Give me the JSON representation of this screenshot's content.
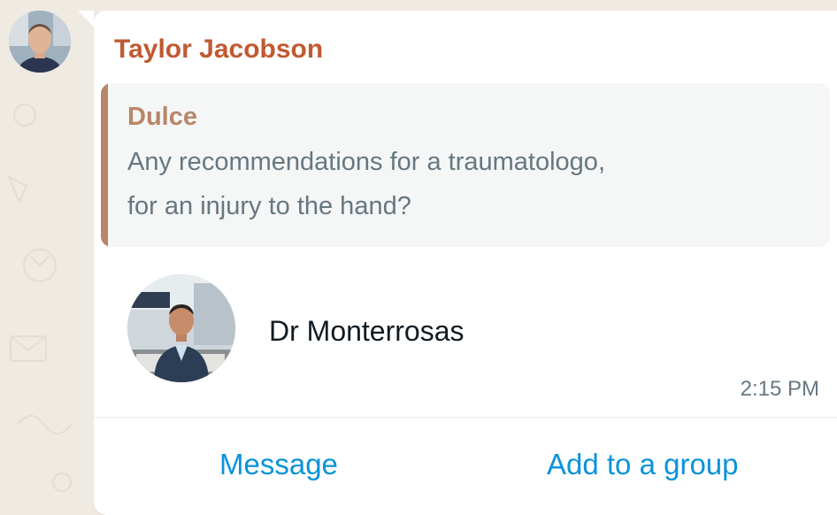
{
  "message": {
    "sender_name": "Taylor Jacobson",
    "quoted": {
      "author": "Dulce",
      "text_lines": [
        "Any recommendations for a traumatologo,",
        "for an injury to the hand?"
      ]
    },
    "contact_card": {
      "name": "Dr Monterrosas"
    },
    "time": "2:15 PM",
    "actions": {
      "message_label": "Message",
      "add_to_group_label": "Add to a group"
    }
  },
  "colors": {
    "sender_name": "#c05a32",
    "quote_accent": "#b8866a",
    "action_link": "#0a93d9",
    "chat_background": "#efeae2"
  },
  "icons": {
    "sender_avatar": "avatar-photo",
    "contact_photo": "contact-photo"
  }
}
